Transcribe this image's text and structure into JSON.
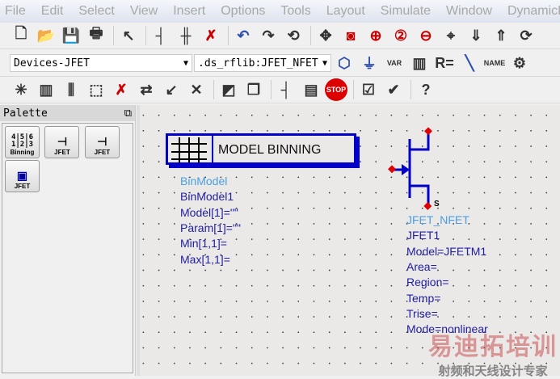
{
  "menu": [
    "File",
    "Edit",
    "Select",
    "View",
    "Insert",
    "Options",
    "Tools",
    "Layout",
    "Simulate",
    "Window",
    "DynamicLink"
  ],
  "toolbar1": [
    {
      "icon": "new-file-icon",
      "g": "🗋"
    },
    {
      "icon": "open-folder-icon",
      "g": "📂"
    },
    {
      "icon": "save-icon",
      "g": "💾"
    },
    {
      "icon": "print-icon",
      "g": "🖶"
    },
    "|",
    {
      "icon": "select-pointer-icon",
      "g": "↖"
    },
    "|",
    {
      "icon": "insert-wire-icon",
      "g": "┤"
    },
    {
      "icon": "insert-pin-icon",
      "g": "╫"
    },
    {
      "icon": "delete-icon",
      "g": "✗"
    },
    "|",
    {
      "icon": "undo-icon",
      "g": "↶"
    },
    {
      "icon": "redo-icon",
      "g": "↷"
    },
    {
      "icon": "repeat-icon",
      "g": "⟲"
    },
    "|",
    {
      "icon": "move-icon",
      "g": "✥"
    },
    {
      "icon": "zoom-area-icon",
      "g": "◙"
    },
    {
      "icon": "zoom-in-icon",
      "g": "⊕"
    },
    {
      "icon": "zoom-in-2-icon",
      "g": "②"
    },
    {
      "icon": "zoom-out-2-icon",
      "g": "⊖"
    },
    {
      "icon": "center-icon",
      "g": "⌖"
    },
    {
      "icon": "push-into-hierarchy-icon",
      "g": "⇓"
    },
    {
      "icon": "pop-out-hierarchy-icon",
      "g": "⇑"
    },
    {
      "icon": "rotate-icon",
      "g": "⟳"
    }
  ],
  "library_combo": "Devices-JFET",
  "component_combo": ".ds_rflib:JFET_NFET",
  "toolbar2": [
    {
      "icon": "port-icon",
      "g": "⬡"
    },
    {
      "icon": "ground-icon",
      "g": "⏚"
    },
    {
      "icon": "var-icon",
      "g": "VAR"
    },
    {
      "icon": "library-icon",
      "g": "▥"
    },
    {
      "icon": "display-template-icon",
      "g": "R="
    },
    {
      "icon": "wire-icon",
      "g": "╲"
    },
    {
      "icon": "wire-label-name-icon",
      "g": "NAME"
    },
    {
      "icon": "settings-icon",
      "g": "⚙"
    }
  ],
  "toolbar3": [
    {
      "icon": "simulate-icon",
      "g": "✳"
    },
    {
      "icon": "component-pins-icon",
      "g": "▥"
    },
    {
      "icon": "component-icon",
      "g": "⫼"
    },
    {
      "icon": "component-select-icon",
      "g": "⬚"
    },
    {
      "icon": "deactivate-icon",
      "g": "✗"
    },
    {
      "icon": "swap-icon",
      "g": "⇄"
    },
    {
      "icon": "origin-icon",
      "g": "↙"
    },
    {
      "icon": "delete-wire-icon",
      "g": "✕"
    },
    "|",
    {
      "icon": "layout-generate-icon",
      "g": "◩"
    },
    {
      "icon": "copy-icon",
      "g": "❐"
    },
    "|",
    {
      "icon": "pin-icon",
      "g": "┤"
    },
    {
      "icon": "document-icon",
      "g": "▤"
    },
    {
      "icon": "stop-icon",
      "g": "STOP"
    },
    "|",
    {
      "icon": "check-icon",
      "g": "☑"
    },
    {
      "icon": "design-check-icon",
      "g": "✔"
    },
    "|",
    {
      "icon": "help-icon",
      "g": "?"
    }
  ],
  "palette": {
    "title": "Palette",
    "items": [
      {
        "label": "Binning",
        "icon": "binning-icon"
      },
      {
        "label": "JFET",
        "icon": "jfet-n-icon"
      },
      {
        "label": "JFET",
        "icon": "jfet-p-icon"
      },
      {
        "label": "JFET",
        "icon": "jfet-model-icon"
      }
    ]
  },
  "binning": {
    "label": "MODEL BINNING",
    "params": [
      "BinModel",
      "BinModel1",
      "Model[1]=\"\"",
      "Param[1]=\"\"",
      "Min[1,1]=",
      "Max[1,1]="
    ]
  },
  "jfet": {
    "pin_label": "S",
    "params": [
      "JFET_NFET",
      "JFET1",
      "Model=JFETM1",
      "Area=",
      "Region=",
      "Temp=",
      "Trise=",
      "Mode=nonlinear"
    ]
  },
  "watermark": {
    "line1": "易迪拓培训",
    "line2": "射频和天线设计专家"
  }
}
